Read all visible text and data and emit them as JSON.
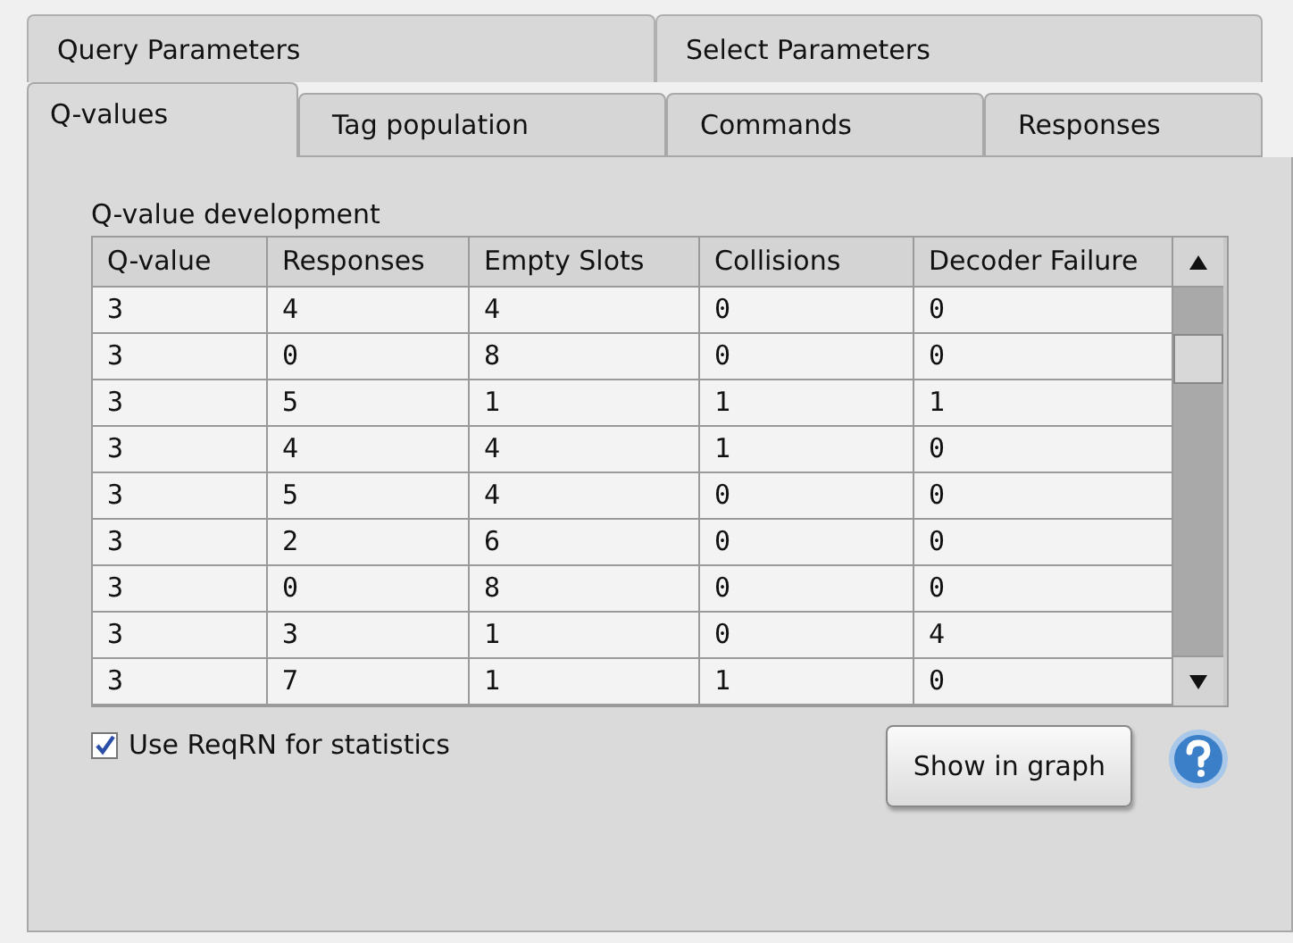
{
  "tabs_top": [
    {
      "label": "Query Parameters",
      "selected": false
    },
    {
      "label": "Select Parameters",
      "selected": false
    }
  ],
  "tabs": [
    {
      "label": "Q-values",
      "selected": true
    },
    {
      "label": "Tag population",
      "selected": false
    },
    {
      "label": "Commands",
      "selected": false
    },
    {
      "label": "Responses",
      "selected": false
    }
  ],
  "table": {
    "title": "Q-value development",
    "columns": [
      "Q-value",
      "Responses",
      "Empty Slots",
      "Collisions",
      "Decoder Failure"
    ],
    "rows": [
      [
        "3",
        "4",
        "4",
        "0",
        "0"
      ],
      [
        "3",
        "0",
        "8",
        "0",
        "0"
      ],
      [
        "3",
        "5",
        "1",
        "1",
        "1"
      ],
      [
        "3",
        "4",
        "4",
        "1",
        "0"
      ],
      [
        "3",
        "5",
        "4",
        "0",
        "0"
      ],
      [
        "3",
        "2",
        "6",
        "0",
        "0"
      ],
      [
        "3",
        "0",
        "8",
        "0",
        "0"
      ],
      [
        "3",
        "3",
        "1",
        "0",
        "4"
      ],
      [
        "3",
        "7",
        "1",
        "1",
        "0"
      ]
    ]
  },
  "checkbox": {
    "label": "Use ReqRN for statistics",
    "checked": true
  },
  "button": {
    "label": "Show in graph"
  }
}
